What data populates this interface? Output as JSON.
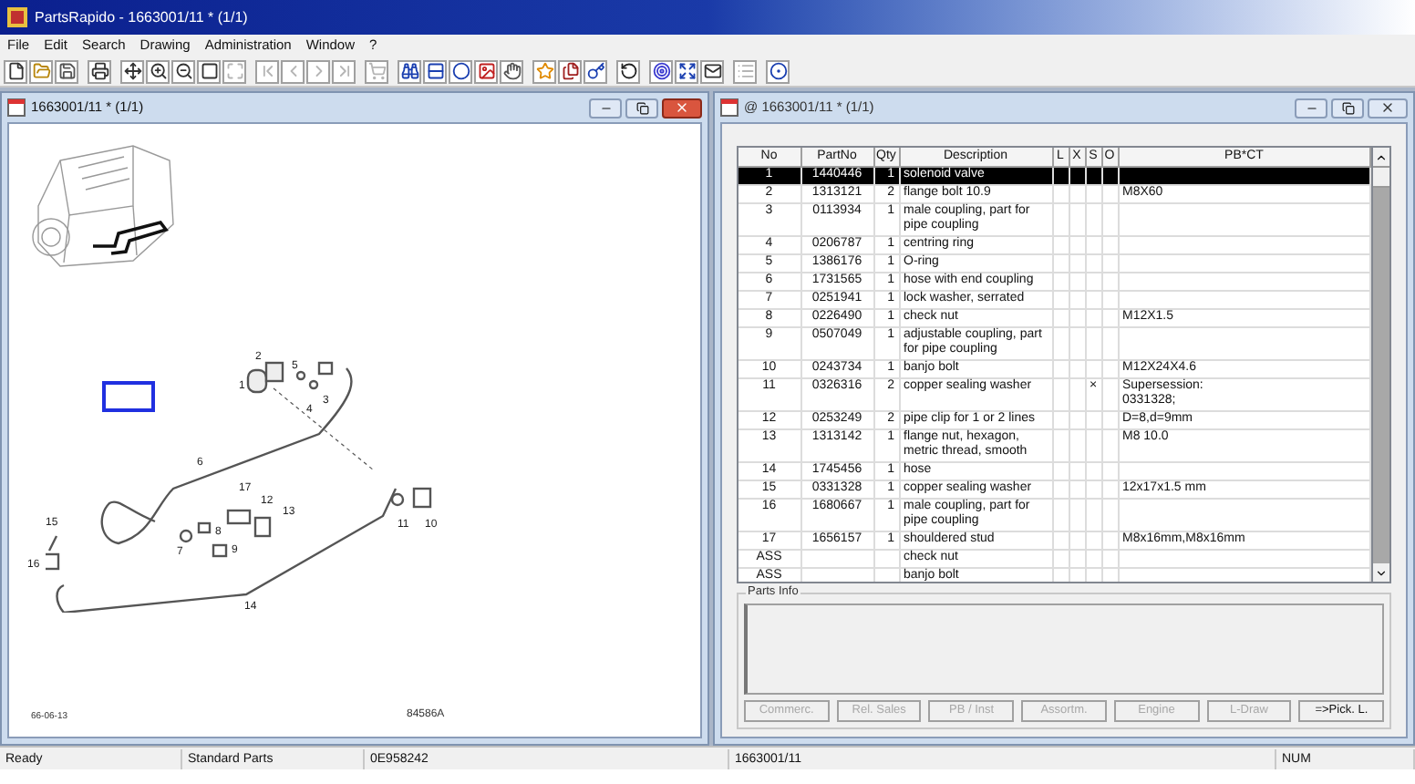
{
  "window": {
    "title": "PartsRapido - 1663001/11 * (1/1)"
  },
  "menu": [
    "File",
    "Edit",
    "Search",
    "Drawing",
    "Administration",
    "Window",
    "?"
  ],
  "toolbar_groups": [
    {
      "buttons": [
        {
          "disabled": false
        },
        {
          "disabled": false
        },
        {
          "disabled": false
        }
      ]
    },
    {
      "buttons": [
        {
          "disabled": false
        }
      ]
    },
    {
      "buttons": [
        {
          "disabled": false
        },
        {
          "disabled": false
        },
        {
          "disabled": false
        },
        {
          "disabled": false
        },
        {
          "disabled": true
        }
      ]
    },
    {
      "buttons": [
        {
          "disabled": true
        },
        {
          "disabled": true
        },
        {
          "disabled": true
        },
        {
          "disabled": true
        }
      ]
    },
    {
      "buttons": [
        {
          "disabled": true
        }
      ]
    },
    {
      "buttons": [
        {
          "disabled": false
        },
        {
          "disabled": false
        },
        {
          "disabled": false
        },
        {
          "disabled": false
        },
        {
          "disabled": false
        }
      ]
    },
    {
      "buttons": [
        {
          "disabled": false
        },
        {
          "disabled": false
        },
        {
          "disabled": false
        }
      ]
    },
    {
      "buttons": [
        {
          "disabled": false
        }
      ]
    },
    {
      "buttons": [
        {
          "disabled": false
        },
        {
          "disabled": false
        },
        {
          "disabled": false
        }
      ]
    },
    {
      "buttons": [
        {
          "disabled": true
        }
      ]
    },
    {
      "buttons": [
        {
          "disabled": false
        }
      ]
    }
  ],
  "drawing_window": {
    "title": "1663001/11 * (1/1)",
    "callouts": [
      "1",
      "2",
      "5",
      "4",
      "3",
      "6",
      "17",
      "12",
      "13",
      "8",
      "9",
      "7",
      "15",
      "16",
      "11",
      "10",
      "14"
    ],
    "date_code": "66-06-13",
    "drawing_number": "84586A"
  },
  "parts_window": {
    "title": "@ 1663001/11 * (1/1)",
    "columns": [
      "No",
      "PartNo",
      "Qty",
      "Description",
      "L",
      "X",
      "S",
      "O",
      "PB*CT"
    ],
    "rows": [
      {
        "no": "1",
        "part_no": "1440446",
        "qty": "1",
        "description": "solenoid valve",
        "selected": true
      },
      {
        "no": "2",
        "part_no": "1313121",
        "qty": "2",
        "description": "flange bolt 10.9",
        "pbct": "M8X60",
        "selected": false
      },
      {
        "no": "3",
        "part_no": "0113934",
        "qty": "1",
        "description": "male coupling, part for pipe coupling",
        "selected": false
      },
      {
        "no": "4",
        "part_no": "0206787",
        "qty": "1",
        "description": "centring ring",
        "selected": false
      },
      {
        "no": "5",
        "part_no": "1386176",
        "qty": "1",
        "description": "O-ring",
        "selected": false
      },
      {
        "no": "6",
        "part_no": "1731565",
        "qty": "1",
        "description": "hose with end coupling",
        "selected": false
      },
      {
        "no": "7",
        "part_no": "0251941",
        "qty": "1",
        "description": "lock washer, serrated",
        "selected": false
      },
      {
        "no": "8",
        "part_no": "0226490",
        "qty": "1",
        "description": "check nut",
        "pbct": "M12X1.5",
        "selected": false
      },
      {
        "no": "9",
        "part_no": "0507049",
        "qty": "1",
        "description": "adjustable coupling, part for pipe coupling",
        "selected": false
      },
      {
        "no": "10",
        "part_no": "0243734",
        "qty": "1",
        "description": "banjo bolt",
        "pbct": "M12X24X4.6",
        "selected": false
      },
      {
        "no": "11",
        "part_no": "0326316",
        "qty": "2",
        "description": "copper sealing washer",
        "s": "×",
        "pbct": "Supersession:\n0331328;",
        "selected": false
      },
      {
        "no": "12",
        "part_no": "0253249",
        "qty": "2",
        "description": "pipe clip for 1 or 2 lines",
        "pbct": "D=8,d=9mm",
        "selected": false
      },
      {
        "no": "13",
        "part_no": "1313142",
        "qty": "1",
        "description": "flange nut, hexagon, metric thread, smooth",
        "pbct": "M8 10.0",
        "selected": false
      },
      {
        "no": "14",
        "part_no": "1745456",
        "qty": "1",
        "description": "hose",
        "selected": false
      },
      {
        "no": "15",
        "part_no": "0331328",
        "qty": "1",
        "description": "copper sealing washer",
        "pbct": "12x17x1.5 mm",
        "selected": false
      },
      {
        "no": "16",
        "part_no": "1680667",
        "qty": "1",
        "description": "male coupling, part for pipe coupling",
        "selected": false
      },
      {
        "no": "17",
        "part_no": "1656157",
        "qty": "1",
        "description": "shouldered stud",
        "pbct": "M8x16mm,M8x16mm",
        "selected": false
      },
      {
        "no": "ASS",
        "description": "check nut",
        "selected": false
      },
      {
        "no": "ASS",
        "description": "banjo bolt",
        "selected": false
      }
    ],
    "parts_info_label": "Parts Info",
    "buttons": [
      {
        "label": "Commerc.",
        "disabled": true
      },
      {
        "label": "Rel. Sales",
        "disabled": true
      },
      {
        "label": "PB / Inst",
        "disabled": true
      },
      {
        "label": "Assortm.",
        "disabled": true
      },
      {
        "label": "Engine",
        "disabled": true
      },
      {
        "label": "L-Draw",
        "disabled": true
      },
      {
        "label": "=>Pick. L.",
        "disabled": false
      }
    ]
  },
  "status_bar": [
    "Ready",
    "Standard Parts",
    "0E958242",
    "1663001/11",
    "NUM"
  ]
}
